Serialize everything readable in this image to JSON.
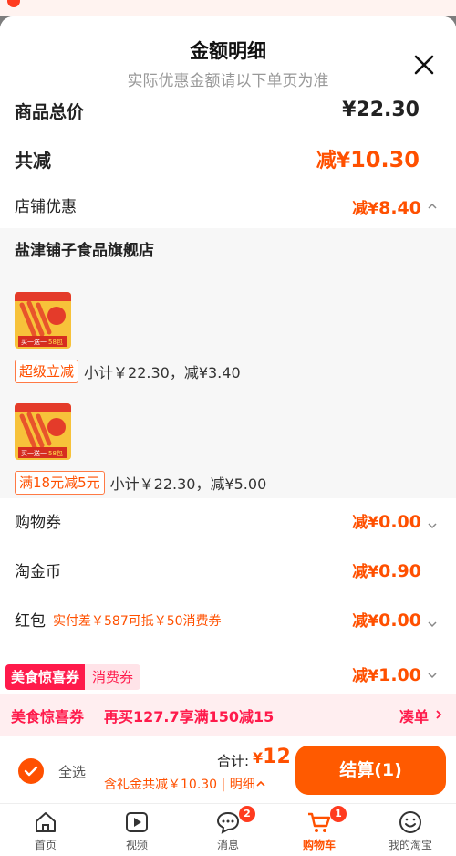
{
  "sheet": {
    "title": "金额明细",
    "subtitle": "实际优惠金额请以下单页为准",
    "cutoff_label": "商品总价",
    "cutoff_value": "¥22.30"
  },
  "total_discount": {
    "label": "共减",
    "prefix": "减¥",
    "value": "10.30"
  },
  "shop_discount": {
    "label": "店铺优惠",
    "prefix": "减¥",
    "value": "8.40"
  },
  "shop": {
    "name": "盐津铺子食品旗舰店",
    "items": [
      {
        "promo_tag": "超级立减",
        "promo_text": "小计￥22.30，减¥3.40",
        "image_badge": "买一送一",
        "image_price": "58包"
      },
      {
        "promo_tag": "满18元减5元",
        "promo_text": "小计￥22.30，减¥5.00",
        "image_badge": "买一送一",
        "image_price": "58包"
      }
    ]
  },
  "coupon": {
    "label": "购物券",
    "prefix": "减¥",
    "value": "0.00"
  },
  "coin": {
    "label": "淘金币",
    "prefix": "减¥",
    "value": "0.90"
  },
  "redpack": {
    "label": "红包",
    "sub": "实付差￥587可抵￥50消费券",
    "prefix": "减¥",
    "value": "0.00"
  },
  "food_coupon": {
    "tag": "美食惊喜券",
    "tag2": "消费券",
    "prefix": "减¥",
    "value": "1.00"
  },
  "banner": {
    "title": "美食惊喜券",
    "text": "再买127.7享满150减15",
    "action": "凑单"
  },
  "checkout": {
    "select_all": "全选",
    "total_label": "合计:",
    "currency": "¥",
    "total_value": "12",
    "gift_text": "含礼金共减￥10.30",
    "detail_link": "明细",
    "pay_button": "结算(1)"
  },
  "tabs": [
    {
      "label": "首页",
      "icon": "home-icon"
    },
    {
      "label": "视频",
      "icon": "video-icon"
    },
    {
      "label": "消息",
      "icon": "message-icon",
      "badge": "2"
    },
    {
      "label": "购物车",
      "icon": "cart-icon",
      "badge": "1",
      "active": true
    },
    {
      "label": "我的淘宝",
      "icon": "profile-icon"
    }
  ],
  "colors": {
    "accent": "#ff5000",
    "promo_red": "#ff1a4b",
    "button": "#ff5a00"
  }
}
